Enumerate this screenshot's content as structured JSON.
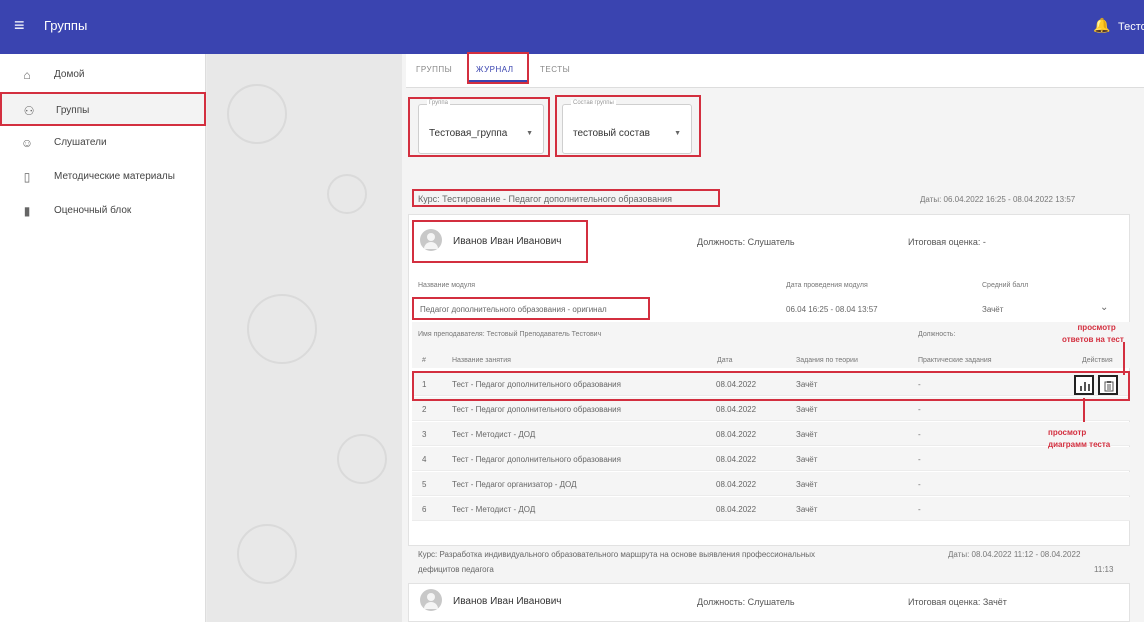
{
  "topbar": {
    "title": "Группы",
    "user": "Тесто"
  },
  "sidebar": {
    "items": [
      {
        "label": "Домой",
        "icon": "home-icon"
      },
      {
        "label": "Группы",
        "icon": "groups-icon"
      },
      {
        "label": "Слушатели",
        "icon": "listeners-icon"
      },
      {
        "label": "Методические материалы",
        "icon": "materials-icon"
      },
      {
        "label": "Оценочный блок",
        "icon": "assessment-icon"
      }
    ]
  },
  "tabs": [
    "ГРУППЫ",
    "ЖУРНАЛ",
    "ТЕСТЫ"
  ],
  "filters": {
    "group": {
      "caption": "Группа",
      "value": "Тестовая_группа"
    },
    "composition": {
      "caption": "Состав группы",
      "value": "тестовый состав"
    }
  },
  "course1": {
    "title": "Курс: Тестирование - Педагог дополнительного образования",
    "dates": "Даты: 06.04.2022 16:25 - 08.04.2022 13:57",
    "listener": {
      "name": "Иванов Иван Иванович",
      "position": "Должность: Слушатель",
      "final_grade": "Итоговая оценка:  -"
    },
    "module_headers": [
      "Название модуля",
      "Дата проведения модуля",
      "Средний балл"
    ],
    "module": {
      "name": "Педагог дополнительного образования - оригинал",
      "dates": "06.04 16:25 - 08.04 13:57",
      "avg": "Зачёт"
    },
    "teacher": "Имя преподавателя: Тестовый Преподаватель Тестович",
    "position_label": "Должность:",
    "lesson_headers": [
      "#",
      "Название занятия",
      "Дата",
      "Задания по теории",
      "Практические задания",
      "Действия"
    ],
    "lessons": [
      {
        "n": "1",
        "name": "Тест - Педагог дополнительного образования",
        "date": "08.04.2022",
        "theory": "Зачёт",
        "practice": "-"
      },
      {
        "n": "2",
        "name": "Тест - Педагог дополнительного образования",
        "date": "08.04.2022",
        "theory": "Зачёт",
        "practice": "-"
      },
      {
        "n": "3",
        "name": "Тест - Методист - ДОД",
        "date": "08.04.2022",
        "theory": "Зачёт",
        "practice": "-"
      },
      {
        "n": "4",
        "name": "Тест - Педагог дополнительного образования",
        "date": "08.04.2022",
        "theory": "Зачёт",
        "practice": "-"
      },
      {
        "n": "5",
        "name": "Тест - Педагог организатор - ДОД",
        "date": "08.04.2022",
        "theory": "Зачёт",
        "practice": "-"
      },
      {
        "n": "6",
        "name": "Тест - Методист - ДОД",
        "date": "08.04.2022",
        "theory": "Зачёт",
        "practice": "-"
      }
    ]
  },
  "course2": {
    "title_line1": "Курс: Разработка индивидуального образовательного маршрута на основе выявления профессиональных",
    "title_line2": "дефицитов педагога",
    "dates_line1": "Даты: 08.04.2022 11:12 - 08.04.2022",
    "dates_line2": "11:13",
    "listener": {
      "name": "Иванов Иван Иванович",
      "position": "Должность: Слушатель",
      "final_grade": "Итоговая оценка:  Зачёт"
    }
  },
  "annotations": {
    "answers": [
      "просмотр",
      "ответов на тест"
    ],
    "diagram": [
      "просмотр",
      "диаграмм теста"
    ]
  },
  "colors": {
    "appbar": "#3a44b0",
    "highlight": "#d32f3f"
  }
}
